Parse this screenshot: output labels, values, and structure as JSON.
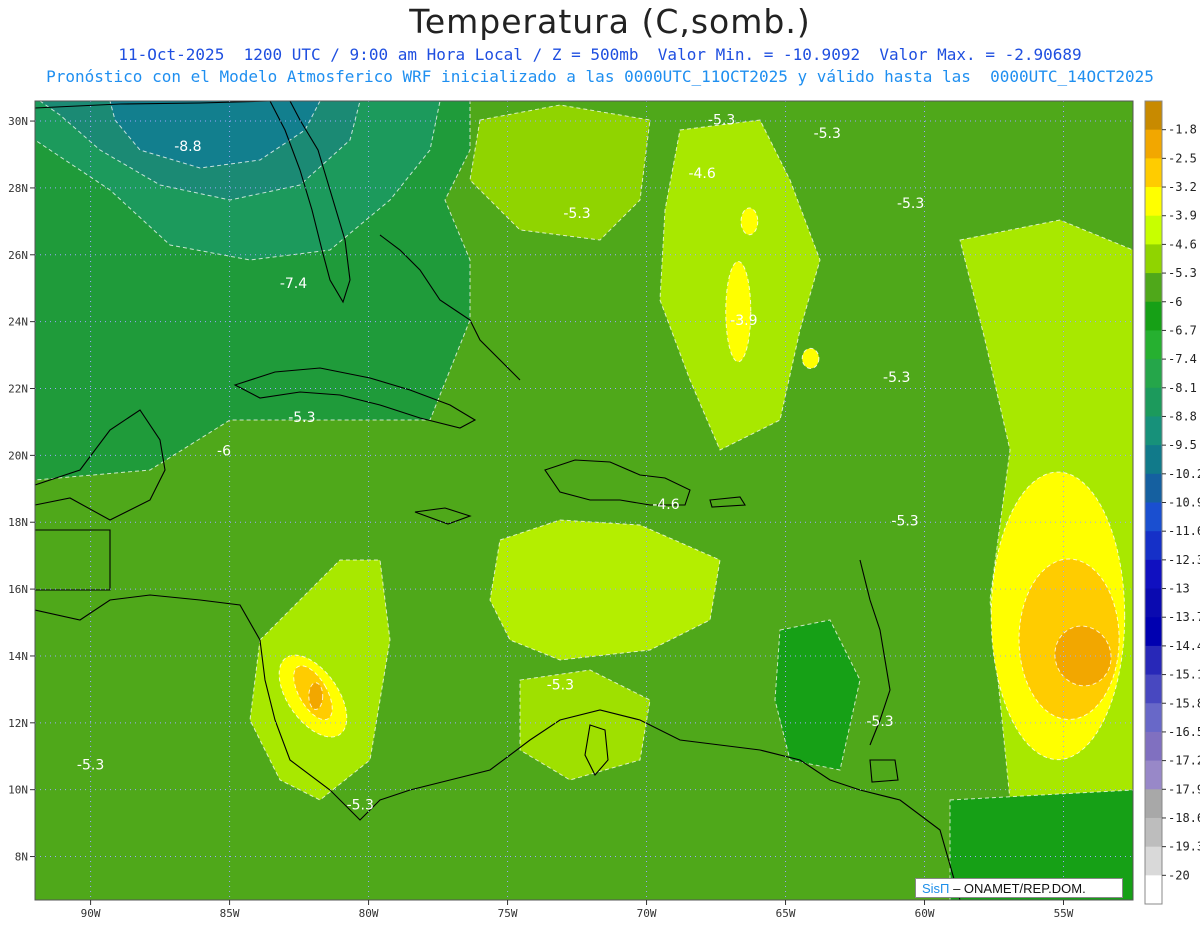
{
  "header": {
    "title": "Temperatura (C,somb.)",
    "subtitle_1": "11-Oct-2025  1200 UTC / 9:00 am Hora Local / Z = 500mb  Valor Min. = -10.9092  Valor Max. = -2.90689",
    "subtitle_2": "Pronóstico con el Modelo Atmosferico WRF inicializado a las 0000UTC_11OCT2025 y válido hasta las  0000UTC_14OCT2025"
  },
  "map": {
    "lon_range": [
      -92,
      -52.5
    ],
    "lat_range": [
      6.7,
      30.6
    ],
    "lon_ticks": [
      "90W",
      "85W",
      "80W",
      "75W",
      "70W",
      "65W",
      "60W",
      "55W"
    ],
    "lon_tick_values": [
      -90,
      -85,
      -80,
      -75,
      -70,
      -65,
      -60,
      -55
    ],
    "lat_ticks": [
      "8N",
      "10N",
      "12N",
      "14N",
      "16N",
      "18N",
      "20N",
      "22N",
      "24N",
      "26N",
      "28N",
      "30N"
    ],
    "lat_tick_values": [
      8,
      10,
      12,
      14,
      16,
      18,
      20,
      22,
      24,
      26,
      28,
      30
    ],
    "grid": true,
    "background_color": "#4fa81a",
    "contour_labels": [
      {
        "text": "-8.8",
        "lon": -86.5,
        "lat": 29.1
      },
      {
        "text": "-7.4",
        "lon": -82.7,
        "lat": 25.0
      },
      {
        "text": "-6",
        "lon": -85.2,
        "lat": 20.0
      },
      {
        "text": "-5.3",
        "lon": -82.4,
        "lat": 21.0
      },
      {
        "text": "-5.3",
        "lon": -72.5,
        "lat": 27.1
      },
      {
        "text": "-5.3",
        "lon": -67.3,
        "lat": 29.9
      },
      {
        "text": "-4.6",
        "lon": -68.0,
        "lat": 28.3
      },
      {
        "text": "-5.3",
        "lon": -63.5,
        "lat": 29.5
      },
      {
        "text": "-5.3",
        "lon": -60.5,
        "lat": 27.4
      },
      {
        "text": "-3.9",
        "lon": -66.5,
        "lat": 23.9
      },
      {
        "text": "-5.3",
        "lon": -61.0,
        "lat": 22.2
      },
      {
        "text": "-4.6",
        "lon": -69.3,
        "lat": 18.4
      },
      {
        "text": "-5.3",
        "lon": -60.7,
        "lat": 17.9
      },
      {
        "text": "-5.3",
        "lon": -73.1,
        "lat": 13.0
      },
      {
        "text": "-5.3",
        "lon": -61.6,
        "lat": 11.9
      },
      {
        "text": "-5.3",
        "lon": -90.0,
        "lat": 10.6
      },
      {
        "text": "-5.3",
        "lon": -80.3,
        "lat": 9.4
      }
    ],
    "fields": [
      {
        "level": -3.9,
        "color": "#ffff00",
        "blobs": [
          {
            "lon": -82.0,
            "lat": 12.8,
            "rx": 0.9,
            "ry": 1.4,
            "rot": -35
          },
          {
            "lon": -66.7,
            "lat": 24.3,
            "rx": 0.45,
            "ry": 1.5,
            "rot": 0
          },
          {
            "lon": -55.2,
            "lat": 15.2,
            "rx": 2.4,
            "ry": 4.3,
            "rot": 0
          },
          {
            "lon": -66.3,
            "lat": 27.0,
            "rx": 0.3,
            "ry": 0.4,
            "rot": 0
          },
          {
            "lon": -64.1,
            "lat": 22.9,
            "rx": 0.3,
            "ry": 0.3,
            "rot": 0
          }
        ]
      },
      {
        "level": -3.2,
        "color": "#ffcc00",
        "blobs": [
          {
            "lon": -54.8,
            "lat": 14.5,
            "rx": 1.8,
            "ry": 2.4,
            "rot": 0
          },
          {
            "lon": -82.0,
            "lat": 12.9,
            "rx": 0.5,
            "ry": 0.9,
            "rot": -30
          }
        ]
      },
      {
        "level": -2.5,
        "color": "#f2a700",
        "blobs": [
          {
            "lon": -54.3,
            "lat": 14.0,
            "rx": 1.0,
            "ry": 0.9,
            "rot": -20
          },
          {
            "lon": -81.9,
            "lat": 12.8,
            "rx": 0.25,
            "ry": 0.4,
            "rot": 0
          }
        ]
      }
    ]
  },
  "colorbar": {
    "labels": [
      "-1.8",
      "-2.5",
      "-3.2",
      "-3.9",
      "-4.6",
      "-5.3",
      "-6",
      "-6.7",
      "-7.4",
      "-8.1",
      "-8.8",
      "-9.5",
      "-10.2",
      "-10.9",
      "-11.6",
      "-12.3",
      "-13",
      "-13.7",
      "-14.4",
      "-15.1",
      "-15.8",
      "-16.5",
      "-17.2",
      "-17.9",
      "-18.6",
      "-19.3",
      "-20"
    ],
    "colors": [
      "#c88a00",
      "#f2a700",
      "#ffcc00",
      "#ffff00",
      "#c8ff00",
      "#90d400",
      "#4fa81a",
      "#16a016",
      "#26b030",
      "#25a64a",
      "#1c9a5c",
      "#17917a",
      "#117a8a",
      "#1560a0",
      "#1a4fd0",
      "#1530c8",
      "#1010c0",
      "#0a0ab0",
      "#0000b0",
      "#2828b8",
      "#4848c0",
      "#6868c8",
      "#8070c0",
      "#9888c8",
      "#a8a8a8",
      "#bdbdbd",
      "#d9d9d9",
      "#ffffff"
    ]
  },
  "credit": {
    "brand": "SisΠ",
    "org": " – ONAMET/REP.DOM."
  }
}
